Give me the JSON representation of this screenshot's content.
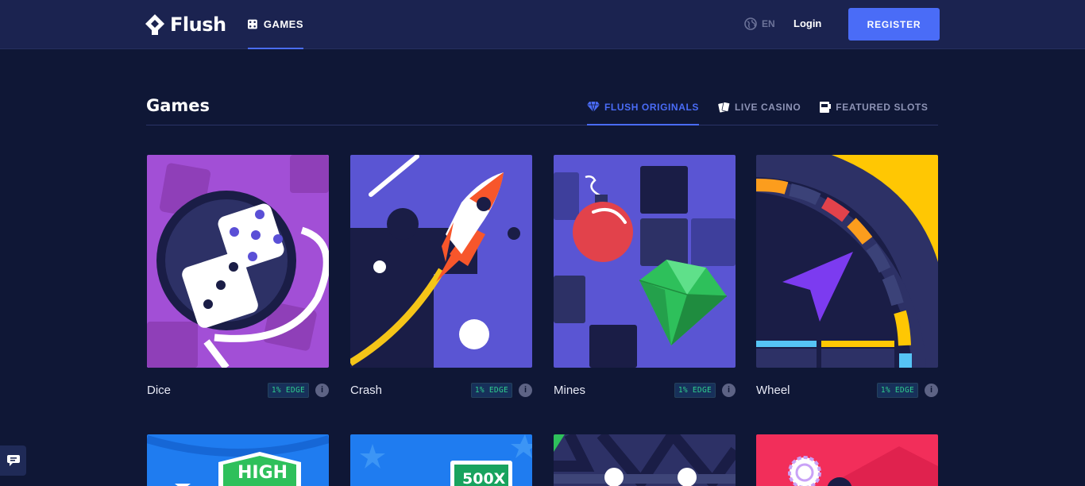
{
  "header": {
    "logo_text": "Flush",
    "nav_games": "GAMES",
    "language": "EN",
    "login": "Login",
    "register": "REGISTER"
  },
  "section": {
    "title": "Games",
    "tabs": [
      {
        "label": "FLUSH ORIGINALS",
        "icon": "diamond-icon",
        "active": true
      },
      {
        "label": "LIVE CASINO",
        "icon": "cards-icon",
        "active": false
      },
      {
        "label": "FEATURED SLOTS",
        "icon": "slot-machine-icon",
        "active": false
      }
    ]
  },
  "games": [
    {
      "name": "Dice",
      "edge": "1% EDGE"
    },
    {
      "name": "Crash",
      "edge": "1% EDGE"
    },
    {
      "name": "Mines",
      "edge": "1% EDGE"
    },
    {
      "name": "Wheel",
      "edge": "1% EDGE"
    }
  ],
  "row2_labels": {
    "high": "HIGH",
    "multiplier": "500X"
  },
  "colors": {
    "accent": "#4a6cf7",
    "background": "#0f1736",
    "header": "#1b2350",
    "edge_text": "#2fcf8f"
  }
}
